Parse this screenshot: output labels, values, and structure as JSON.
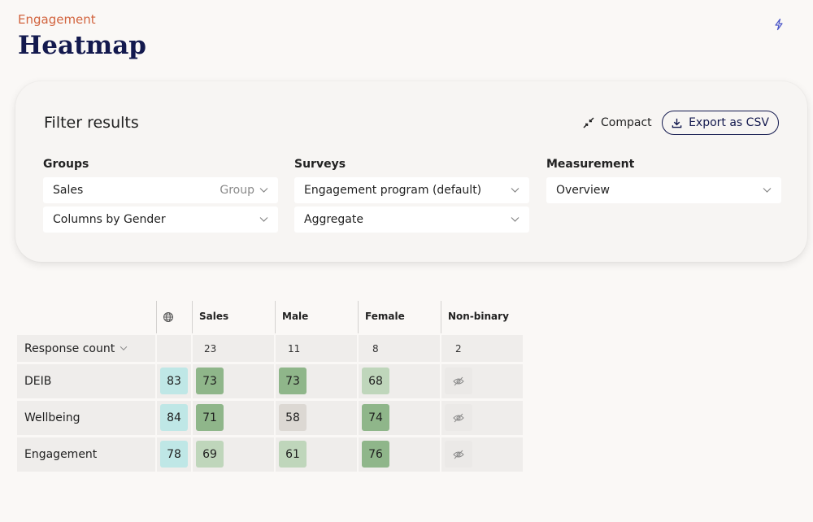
{
  "header": {
    "eyebrow": "Engagement",
    "title": "Heatmap"
  },
  "icons": {
    "top_right": "bolt-icon",
    "compact": "collapse-arrows-icon",
    "export": "download-icon",
    "chevron": "chevron-down-icon",
    "globe": "globe-icon",
    "hidden": "eye-slash-icon"
  },
  "filters": {
    "title": "Filter results",
    "compact_label": "Compact",
    "export_label": "Export as CSV",
    "groups": {
      "label": "Groups",
      "group_select": {
        "value": "Sales",
        "hint": "Group"
      },
      "columns_select": {
        "value": "Columns by Gender"
      }
    },
    "surveys": {
      "label": "Surveys",
      "program_select": {
        "value": "Engagement program (default)"
      },
      "aggregate_select": {
        "value": "Aggregate"
      }
    },
    "measurement": {
      "label": "Measurement",
      "select": {
        "value": "Overview"
      }
    }
  },
  "heatmap": {
    "columns": [
      "Sales",
      "Male",
      "Female",
      "Non-binary"
    ],
    "response_count_label": "Response count",
    "response_counts": [
      "",
      "23",
      "11",
      "8",
      "2"
    ],
    "rows": [
      {
        "label": "DEIB",
        "global": "83",
        "values": [
          "73",
          "73",
          "68",
          ""
        ]
      },
      {
        "label": "Wellbeing",
        "global": "84",
        "values": [
          "71",
          "58",
          "74",
          ""
        ]
      },
      {
        "label": "Engagement",
        "global": "78",
        "values": [
          "69",
          "61",
          "76",
          ""
        ]
      }
    ]
  },
  "colors": {
    "accent": "#d2643f",
    "navy": "#13194e",
    "global_cell": "#bfe7e6",
    "high_score": "#8fb68a",
    "mid_score": "#a8c9a3",
    "low_score": "#bfd6bb",
    "neutral_score": "#dcd8d3"
  }
}
